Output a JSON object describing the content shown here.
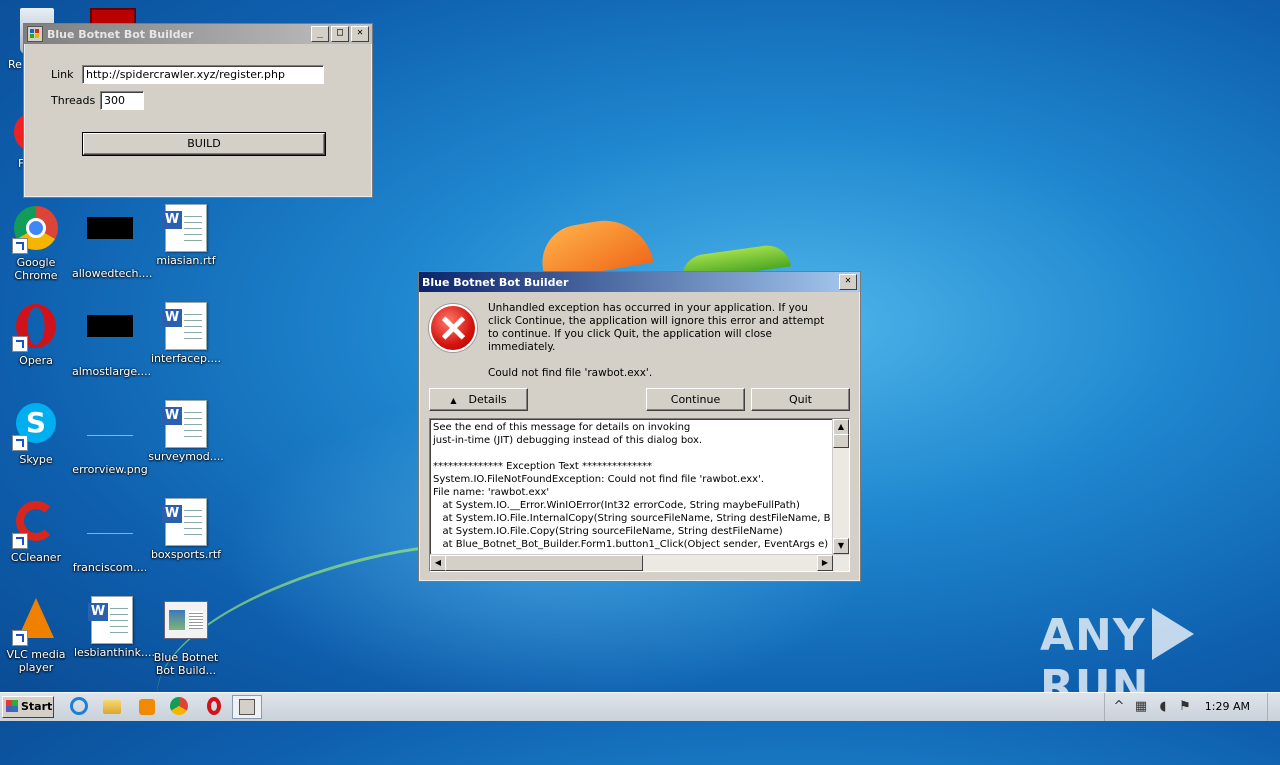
{
  "desktop": {
    "icons": [
      {
        "label": "Google Chrome",
        "icon": "chrome-icon"
      },
      {
        "label": "allowedtech....",
        "icon": "black-image-icon"
      },
      {
        "label": "miasian.rtf",
        "icon": "word-document-icon"
      },
      {
        "label": "Opera",
        "icon": "opera-icon"
      },
      {
        "label": "almostlarge....",
        "icon": "black-image-icon"
      },
      {
        "label": "interfacep....",
        "icon": "word-document-icon"
      },
      {
        "label": "Skype",
        "icon": "skype-icon"
      },
      {
        "label": "errorview.png",
        "icon": "image-file-icon"
      },
      {
        "label": "surveymod....",
        "icon": "word-document-icon"
      },
      {
        "label": "CCleaner",
        "icon": "ccleaner-icon"
      },
      {
        "label": "franciscom....",
        "icon": "image-file-icon"
      },
      {
        "label": "boxsports.rtf",
        "icon": "word-document-icon"
      },
      {
        "label": "VLC media player",
        "icon": "vlc-icon"
      },
      {
        "label": "lesbianthink....",
        "icon": "word-document-icon"
      },
      {
        "label": "Blue Botnet Bot Build...",
        "icon": "application-icon"
      }
    ],
    "partial_labels": {
      "top_left": "Re",
      "mid_left": "F"
    }
  },
  "builder_window": {
    "title": "Blue Botnet Bot Builder",
    "link_label": "Link",
    "link_value": "http://spidercrawler.xyz/register.php",
    "threads_label": "Threads",
    "threads_value": "300",
    "build_label": "BUILD"
  },
  "error_dialog": {
    "title": "Blue Botnet Bot Builder",
    "message": "Unhandled exception has occurred in your application. If you click Continue, the application will ignore this error and attempt to continue. If you click Quit, the application will close immediately.",
    "detail_message": "Could not find file 'rawbot.exx'.",
    "details_label": "Details",
    "continue_label": "Continue",
    "quit_label": "Quit",
    "details_text": "See the end of this message for details on invoking\njust-in-time (JIT) debugging instead of this dialog box.\n\n************** Exception Text **************\nSystem.IO.FileNotFoundException: Could not find file 'rawbot.exx'.\nFile name: 'rawbot.exx'\n   at System.IO.__Error.WinIOError(Int32 errorCode, String maybeFullPath)\n   at System.IO.File.InternalCopy(String sourceFileName, String destFileName, Boolean\n   at System.IO.File.Copy(String sourceFileName, String destFileName)\n   at Blue_Botnet_Bot_Builder.Form1.button1_Click(Object sender, EventArgs e)"
  },
  "taskbar": {
    "start_label": "Start",
    "pinned": [
      "ie-icon",
      "explorer-icon",
      "media-player-icon",
      "chrome-icon",
      "opera-icon",
      "builder-app-icon"
    ],
    "clock": "1:29 AM"
  },
  "watermark": {
    "left": "ANY",
    "right": "RUN"
  },
  "colors": {
    "title_active": "#0a246a",
    "title_inactive": "#7f7f7f",
    "dialog_bg": "#d4d0c8",
    "desktop": "#1f87cf"
  }
}
